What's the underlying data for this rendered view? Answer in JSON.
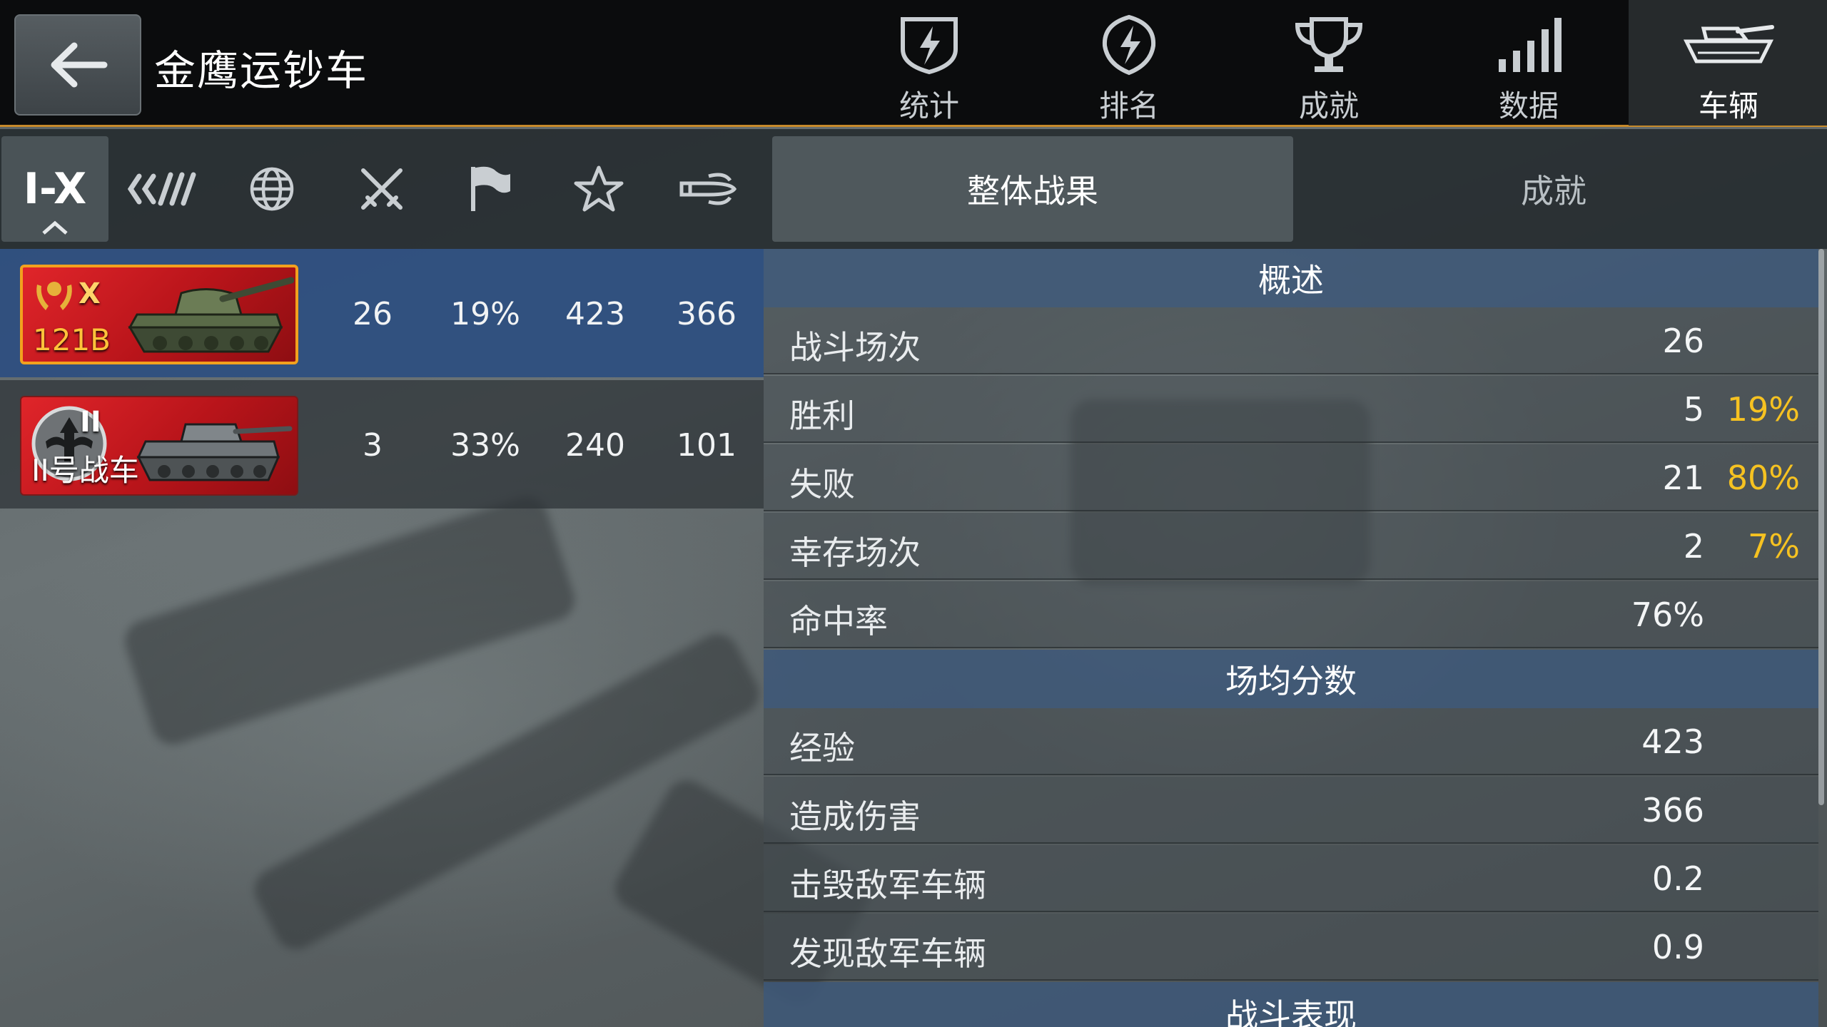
{
  "header": {
    "title": "金鹰运钞车"
  },
  "nav": {
    "tabs": [
      {
        "label": "统计",
        "icon": "shield-lightning-icon"
      },
      {
        "label": "排名",
        "icon": "badge-lightning-icon"
      },
      {
        "label": "成就",
        "icon": "trophy-icon"
      },
      {
        "label": "数据",
        "icon": "bars-icon"
      },
      {
        "label": "车辆",
        "icon": "tank-icon"
      }
    ],
    "active_index": 4
  },
  "filters": {
    "tier_label": "I-X",
    "items": [
      "tier-filter",
      "vehicle-class-icon",
      "nation-globe-icon",
      "crossed-swords-icon",
      "flag-icon",
      "star-icon",
      "shell-icon"
    ]
  },
  "vehicles": [
    {
      "name": "121B",
      "tier": "X",
      "battles": "26",
      "win_rate": "19%",
      "avg_xp": "423",
      "avg_damage": "366",
      "selected": true
    },
    {
      "name": "II号战车",
      "tier": "II",
      "battles": "3",
      "win_rate": "33%",
      "avg_xp": "240",
      "avg_damage": "101",
      "selected": false
    }
  ],
  "right_tabs": {
    "overall": "整体战果",
    "achievements": "成就"
  },
  "sections": {
    "overview": {
      "title": "概述",
      "rows": [
        {
          "label": "战斗场次",
          "value": "26",
          "pct": ""
        },
        {
          "label": "胜利",
          "value": "5",
          "pct": "19%"
        },
        {
          "label": "失败",
          "value": "21",
          "pct": "80%"
        },
        {
          "label": "幸存场次",
          "value": "2",
          "pct": "7%"
        },
        {
          "label": "命中率",
          "value": "76%",
          "pct": ""
        }
      ]
    },
    "average": {
      "title": "场均分数",
      "rows": [
        {
          "label": "经验",
          "value": "423"
        },
        {
          "label": "造成伤害",
          "value": "366"
        },
        {
          "label": "击毁敌军车辆",
          "value": "0.2"
        },
        {
          "label": "发现敌军车辆",
          "value": "0.9"
        }
      ]
    },
    "performance": {
      "title": "战斗表现"
    }
  },
  "colors": {
    "accent": "#c78a2a",
    "highlight_pct": "#f6c221",
    "selected_row": "#2c4e80",
    "vehicle_card": "#c8181e"
  }
}
